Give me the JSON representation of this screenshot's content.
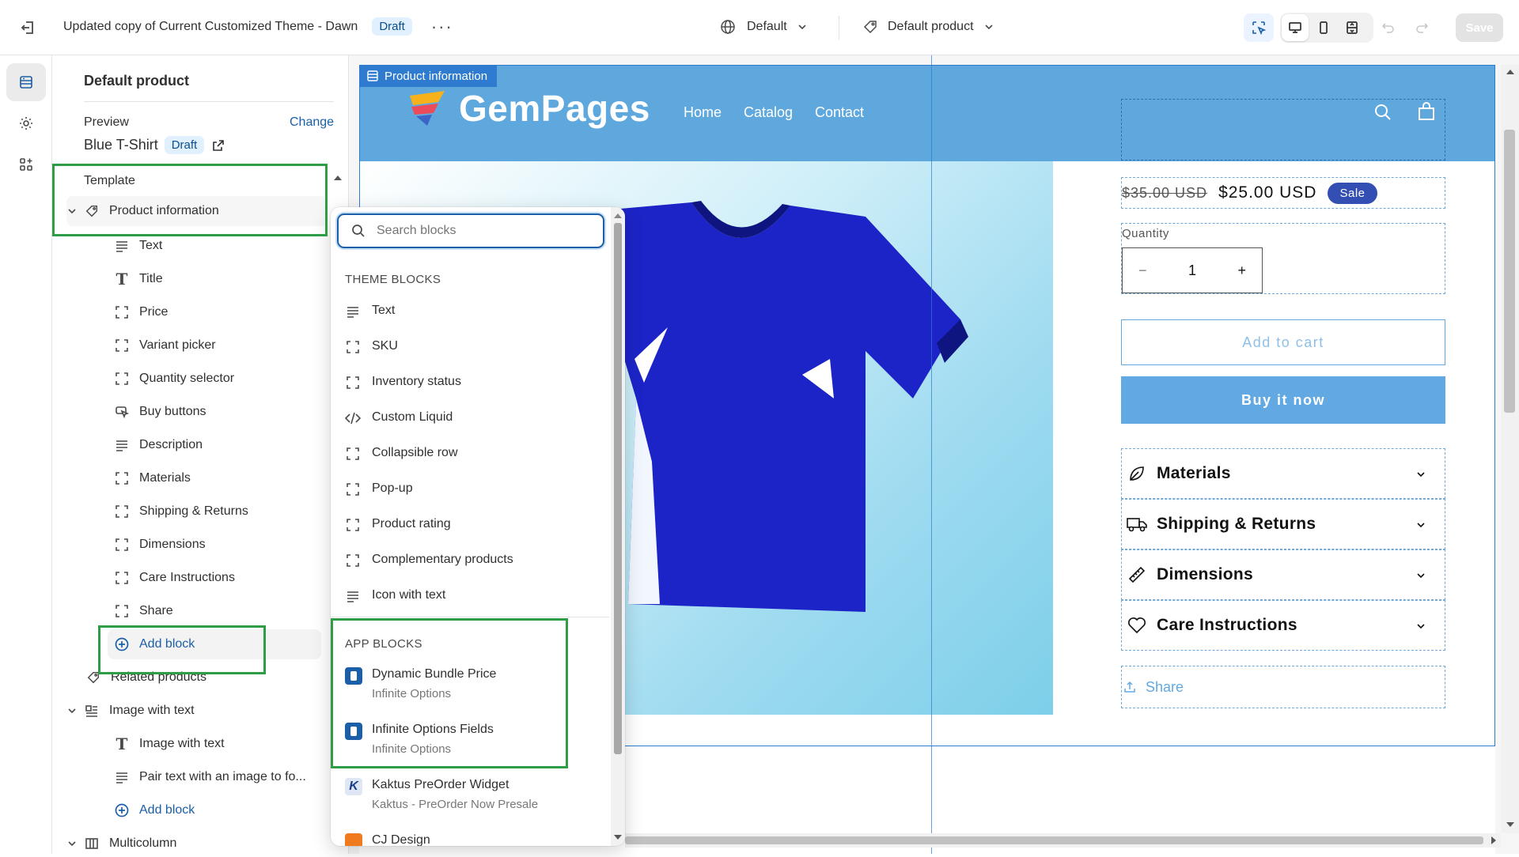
{
  "topbar": {
    "title": "Updated copy of Current Customized Theme - Dawn",
    "status_badge": "Draft",
    "locale_select": "Default",
    "template_select": "Default product",
    "save_label": "Save"
  },
  "sidebar": {
    "heading": "Default product",
    "preview_label": "Preview",
    "change_link": "Change",
    "preview_product": "Blue T-Shirt",
    "preview_badge": "Draft",
    "template_label": "Template",
    "section_product_info": "Product information",
    "blocks": [
      {
        "label": "Text",
        "icon": "text-lines-icon"
      },
      {
        "label": "Title",
        "icon": "title-t-icon"
      },
      {
        "label": "Price",
        "icon": "block-frame-icon"
      },
      {
        "label": "Variant picker",
        "icon": "block-frame-icon"
      },
      {
        "label": "Quantity selector",
        "icon": "block-frame-icon"
      },
      {
        "label": "Buy buttons",
        "icon": "cursor-click-icon"
      },
      {
        "label": "Description",
        "icon": "text-lines-icon"
      },
      {
        "label": "Materials",
        "icon": "block-frame-icon"
      },
      {
        "label": "Shipping & Returns",
        "icon": "block-frame-icon"
      },
      {
        "label": "Dimensions",
        "icon": "block-frame-icon"
      },
      {
        "label": "Care Instructions",
        "icon": "block-frame-icon"
      },
      {
        "label": "Share",
        "icon": "block-frame-icon"
      }
    ],
    "add_block_label": "Add block",
    "related_products": "Related products",
    "image_with_text_section": "Image with text",
    "iwt_blocks": [
      "Image with text",
      "Pair text with an image to fo..."
    ],
    "add_block_label_2": "Add block",
    "multicolumn": "Multicolumn"
  },
  "popover": {
    "search_placeholder": "Search blocks",
    "theme_blocks_heading": "THEME BLOCKS",
    "theme_blocks": [
      {
        "label": "Text",
        "icon": "text-lines-icon"
      },
      {
        "label": "SKU",
        "icon": "block-frame-icon"
      },
      {
        "label": "Inventory status",
        "icon": "block-frame-icon"
      },
      {
        "label": "Custom Liquid",
        "icon": "code-icon"
      },
      {
        "label": "Collapsible row",
        "icon": "block-frame-icon"
      },
      {
        "label": "Pop-up",
        "icon": "block-frame-icon"
      },
      {
        "label": "Product rating",
        "icon": "block-frame-icon"
      },
      {
        "label": "Complementary products",
        "icon": "block-frame-icon"
      },
      {
        "label": "Icon with text",
        "icon": "text-lines-icon"
      }
    ],
    "app_blocks_heading": "APP BLOCKS",
    "app_blocks": [
      {
        "name": "Dynamic Bundle Price",
        "app": "Infinite Options"
      },
      {
        "name": "Infinite Options Fields",
        "app": "Infinite Options"
      },
      {
        "name": "Kaktus PreOrder Widget",
        "app": "Kaktus - PreOrder Now Presale"
      },
      {
        "name": "CJ Design",
        "app": ""
      }
    ]
  },
  "preview": {
    "section_tag": "Product information",
    "brand": "GemPages",
    "nav": [
      "Home",
      "Catalog",
      "Contact"
    ],
    "price_compare": "$35.00 USD",
    "price": "$25.00 USD",
    "sale_badge": "Sale",
    "quantity_label": "Quantity",
    "quantity_value": "1",
    "minus": "−",
    "plus": "+",
    "add_to_cart": "Add to cart",
    "buy_now": "Buy it now",
    "accordions": [
      "Materials",
      "Shipping & Returns",
      "Dimensions",
      "Care Instructions"
    ],
    "share": "Share"
  },
  "colors": {
    "header_blue": "#5fa8de",
    "accent_green": "#2e9d45",
    "button_blue": "#62a9e3",
    "shirt_blue": "#1c24c8"
  }
}
